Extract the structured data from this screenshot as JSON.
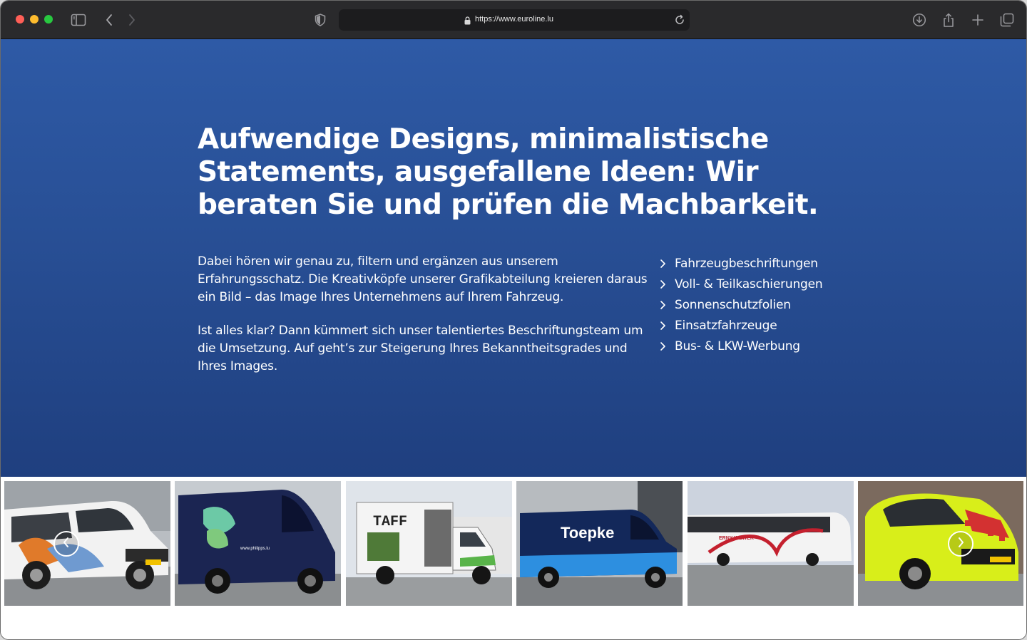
{
  "browser": {
    "url": "https://www.euroline.lu",
    "icons": [
      "sidebar-icon",
      "back-icon",
      "forward-icon",
      "shield-icon",
      "lock-icon",
      "reload-icon",
      "download-icon",
      "share-icon",
      "new-tab-icon",
      "tabs-overview-icon"
    ]
  },
  "hero": {
    "headline": "Aufwendige Designs, minimalistische Statements, ausgefallene Ideen: Wir beraten Sie und prüfen die Machbarkeit.",
    "paragraph_1": "Dabei hören wir genau zu, filtern und ergänzen aus unserem Erfahrungsschatz. Die Kreativköpfe unserer Grafikabteilung kreieren daraus ein Bild – das Image Ihres Unternehmens auf Ihrem Fahrzeug.",
    "paragraph_2": "Ist alles klar? Dann kümmert sich unser talentiertes Beschriftungsteam um die Umsetzung. Auf geht’s zur Steigerung Ihres Bekanntheitsgrades und Ihres Images.",
    "links": [
      {
        "label": "Fahrzeugbeschriftungen"
      },
      {
        "label": "Voll- & Teilkaschierungen"
      },
      {
        "label": "Sonnenschutzfolien"
      },
      {
        "label": "Einsatzfahrzeuge"
      },
      {
        "label": "Bus- & LKW-Werbung"
      }
    ],
    "colors": {
      "gradient_top": "#2e5aa6",
      "gradient_bottom": "#1f3f7f",
      "text": "#ffffff"
    }
  },
  "gallery": {
    "images": [
      {
        "name": "van-white-wrapped"
      },
      {
        "name": "van-navy-philipps",
        "caption": "www.philipps.lu"
      },
      {
        "name": "truck-taff",
        "caption": "TAFF"
      },
      {
        "name": "van-toepke",
        "caption": "Toepke"
      },
      {
        "name": "bus-erny-wewer",
        "caption": "ERNY WEWER"
      },
      {
        "name": "suv-emergency"
      }
    ],
    "prev_icon": "chevron-left-icon",
    "next_icon": "chevron-right-icon"
  }
}
